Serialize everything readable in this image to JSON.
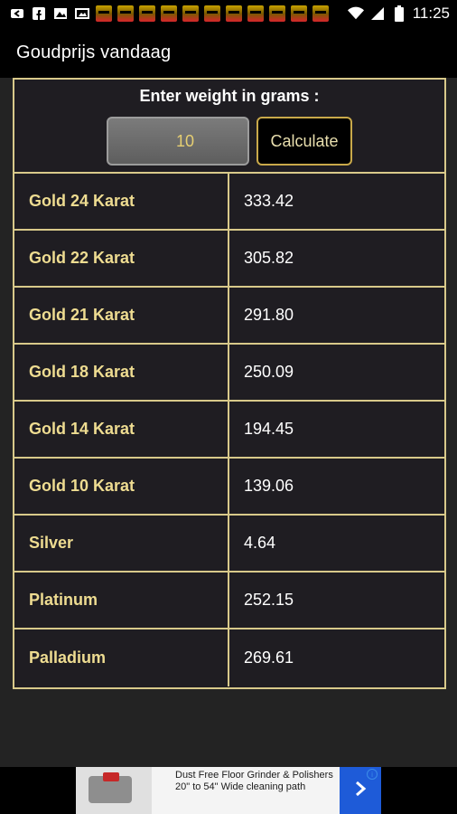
{
  "status_bar": {
    "time": "11:25",
    "icons": [
      "back-icon",
      "facebook-icon",
      "image-gallery-icon",
      "photo-icon",
      "app-notification-icon",
      "wifi-icon",
      "signal-icon",
      "battery-icon"
    ]
  },
  "app_bar": {
    "title": "Goudprijs vandaag"
  },
  "calculator": {
    "prompt": "Enter weight in grams :",
    "weight_value": "10",
    "button_label": "Calculate"
  },
  "rows": [
    {
      "label": "Gold 24 Karat",
      "value": "333.42"
    },
    {
      "label": "Gold 22 Karat",
      "value": "305.82"
    },
    {
      "label": "Gold 21 Karat",
      "value": "291.80"
    },
    {
      "label": "Gold 18 Karat",
      "value": "250.09"
    },
    {
      "label": "Gold 14 Karat",
      "value": "194.45"
    },
    {
      "label": "Gold 10 Karat",
      "value": "139.06"
    },
    {
      "label": "Silver",
      "value": "4.64"
    },
    {
      "label": "Platinum",
      "value": "252.15"
    },
    {
      "label": "Palladium",
      "value": "269.61"
    }
  ],
  "ad": {
    "text": "Dust Free Floor Grinder & Polishers 20\" to 54\" Wide cleaning path",
    "cta_icon": "chevron-right-icon",
    "adchoices_icon": "info-icon"
  },
  "colors": {
    "accent_gold": "#d8c98a",
    "label_gold": "#eedc91",
    "panel_bg": "#1f1d22",
    "page_bg": "#232323",
    "ad_cta_blue": "#1e5bd8"
  }
}
